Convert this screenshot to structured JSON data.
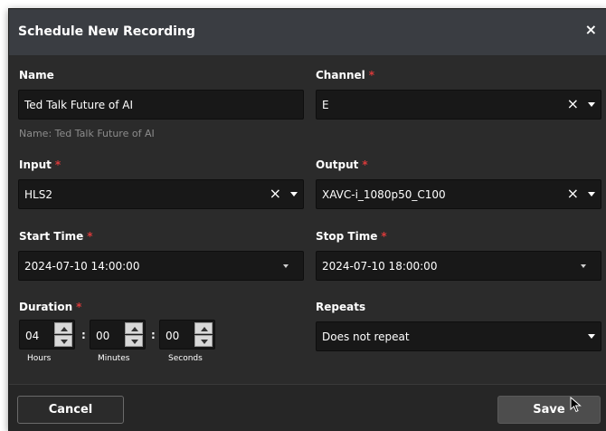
{
  "dialog": {
    "title": "Schedule New Recording",
    "close_icon": "×"
  },
  "form": {
    "name": {
      "label": "Name",
      "value": "Ted Talk Future of AI",
      "hint": "Name: Ted Talk Future of AI"
    },
    "channel": {
      "label": "Channel",
      "required": "*",
      "value": "E",
      "clear_icon": "×"
    },
    "input": {
      "label": "Input",
      "required": "*",
      "value": "HLS2",
      "clear_icon": "×"
    },
    "output": {
      "label": "Output",
      "required": "*",
      "value": "XAVC-i_1080p50_C100",
      "clear_icon": "×"
    },
    "start_time": {
      "label": "Start Time",
      "required": "*",
      "value": "2024-07-10 14:00:00"
    },
    "stop_time": {
      "label": "Stop Time",
      "required": "*",
      "value": "2024-07-10 18:00:00"
    },
    "duration": {
      "label": "Duration",
      "required": "*",
      "separator": ":",
      "hours": {
        "value": "04",
        "label": "Hours"
      },
      "minutes": {
        "value": "00",
        "label": "Minutes"
      },
      "seconds": {
        "value": "00",
        "label": "Seconds"
      }
    },
    "repeats": {
      "label": "Repeats",
      "value": "Does not repeat"
    }
  },
  "footer": {
    "cancel_label": "Cancel",
    "save_label": "Save"
  },
  "colors": {
    "dialog_bg": "#2b2b2b",
    "titlebar_bg": "#3a3d42",
    "input_bg": "#181818",
    "required": "#d93a3a"
  },
  "icons": [
    "close-icon",
    "clear-icon",
    "chevron-down-icon",
    "chevron-up-icon",
    "mouse-pointer-icon"
  ]
}
